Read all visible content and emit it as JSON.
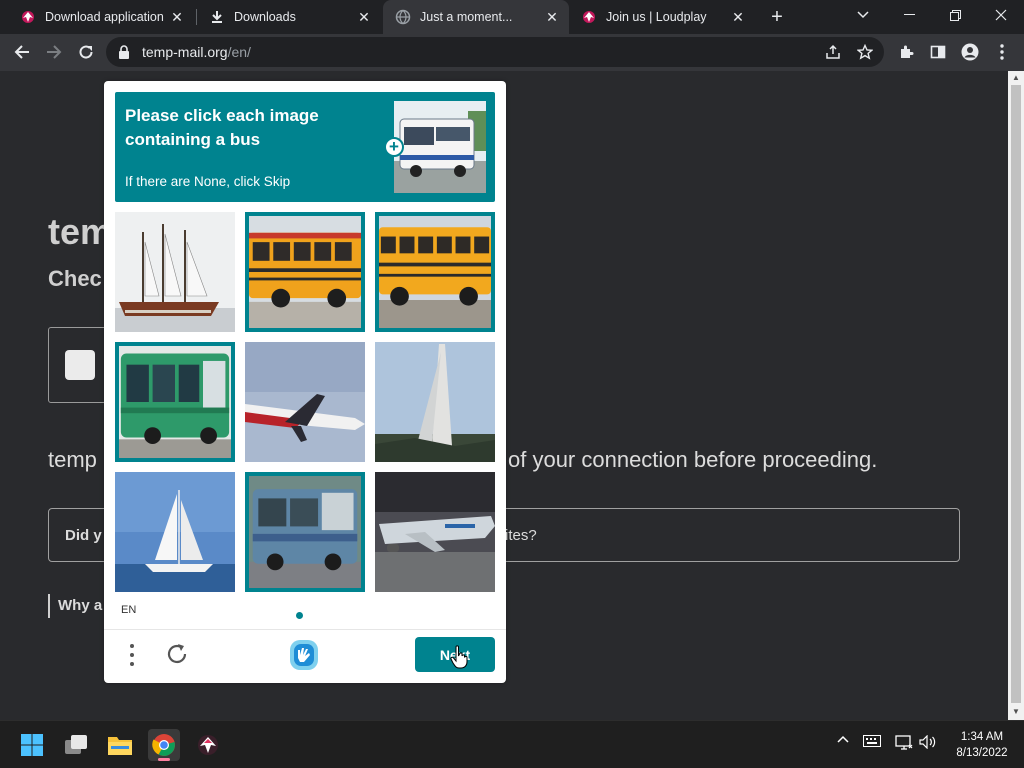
{
  "browser": {
    "tabs": [
      {
        "title": "Download application |",
        "active": false
      },
      {
        "title": "Downloads",
        "active": false
      },
      {
        "title": "Just a moment...",
        "active": true
      },
      {
        "title": "Join us | Loudplay",
        "active": false
      }
    ],
    "address": {
      "host": "temp-mail.org",
      "path": "/en/"
    }
  },
  "page": {
    "logo_partial": "tem",
    "check_partial": "Chec",
    "review_left": "temp",
    "review_right": "of your connection before proceeding.",
    "did_left": "Did y",
    "did_right": "ites?",
    "why_partial": "Why a"
  },
  "captcha": {
    "prompt_title": "Please click each image containing a bus",
    "prompt_hint": "If there are None, click Skip",
    "tiles": [
      {
        "subject": "sailing ship",
        "selected": false
      },
      {
        "subject": "yellow school bus",
        "selected": true
      },
      {
        "subject": "yellow school bus",
        "selected": true
      },
      {
        "subject": "green bus",
        "selected": true
      },
      {
        "subject": "airplane",
        "selected": false
      },
      {
        "subject": "sail",
        "selected": false
      },
      {
        "subject": "sailboat",
        "selected": false
      },
      {
        "subject": "blue bus",
        "selected": true
      },
      {
        "subject": "airliner",
        "selected": false
      }
    ],
    "language": "EN",
    "next_label": "Next"
  },
  "taskbar": {
    "time": "1:34 AM",
    "date": "8/13/2022"
  },
  "colors": {
    "accent": "#00838f",
    "tab_bg": "#202124",
    "toolbar_bg": "#35363a"
  }
}
